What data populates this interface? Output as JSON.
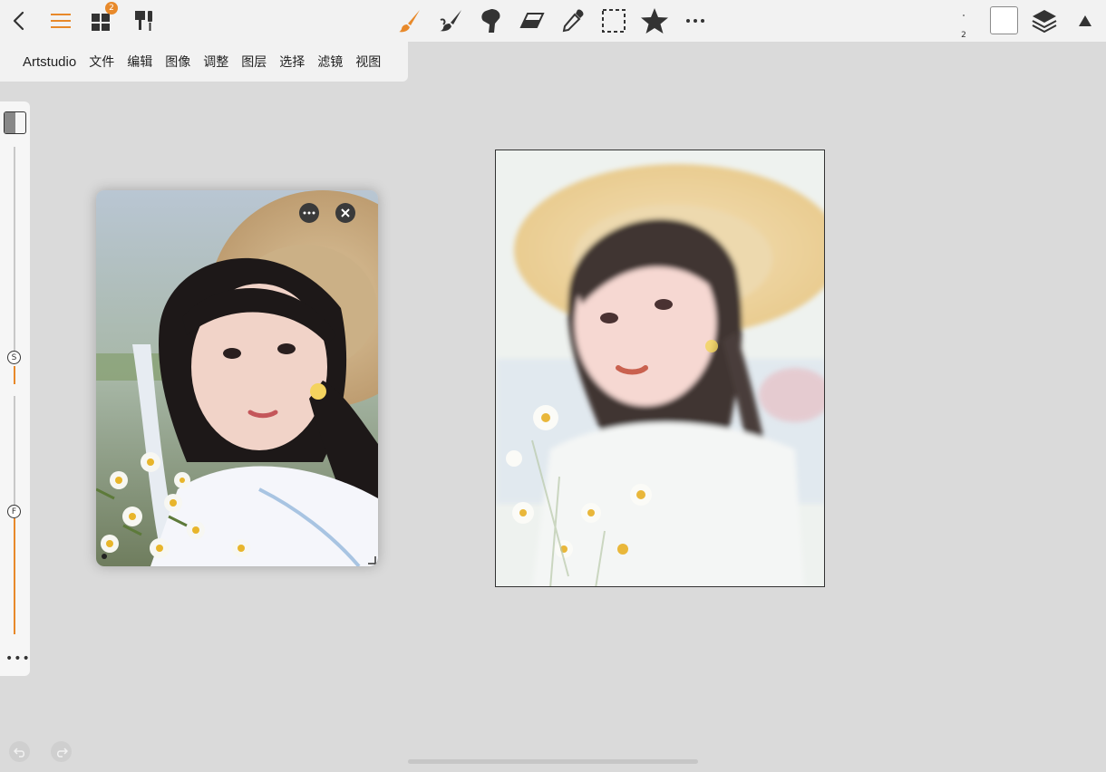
{
  "toolbar": {
    "gallery_badge": "2",
    "brush_size": "2",
    "accent_color": "#e8892a",
    "icons_left": [
      "back-icon",
      "menu-icon",
      "gallery-icon",
      "brush-settings-icon"
    ],
    "icons_tools": [
      "paintbrush-icon",
      "smudge-icon",
      "blur-icon",
      "eraser-icon",
      "eyedropper-icon",
      "selection-icon",
      "favorite-star-icon",
      "more-icon"
    ],
    "icons_right": [
      "color-swatch",
      "layers-icon",
      "collapse-icon"
    ]
  },
  "menu": {
    "app": "Artstudio",
    "items": [
      "文件",
      "编辑",
      "图像",
      "调整",
      "图层",
      "选择",
      "滤镜",
      "视图"
    ]
  },
  "sliders": {
    "size_label": "S",
    "flow_label": "F"
  }
}
